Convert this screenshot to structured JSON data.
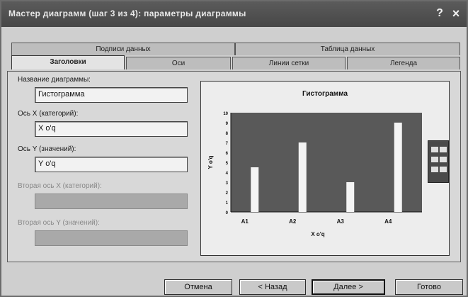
{
  "window": {
    "title": "Мастер диаграмм (шаг 3 из 4): параметры диаграммы",
    "help_glyph": "?",
    "close_glyph": "×"
  },
  "tabs_top": [
    {
      "label": "Подписи данных"
    },
    {
      "label": "Таблица данных"
    }
  ],
  "tabs_bottom": [
    {
      "label": "Заголовки"
    },
    {
      "label": "Оси"
    },
    {
      "label": "Линии сетки"
    },
    {
      "label": "Легенда"
    }
  ],
  "form": {
    "chart_name_label": "Название диаграммы:",
    "chart_name_value": "Гистограмма",
    "x_axis_label": "Ось X (категорий):",
    "x_axis_value": "X o'q",
    "y_axis_label": "Ось Y (значений):",
    "y_axis_value": "Y o'q",
    "x2_axis_label": "Вторая ось X (категорий):",
    "y2_axis_label": "Вторая ось Y (значений):"
  },
  "chart_data": {
    "type": "bar",
    "title": "Гистограмма",
    "xlabel": "X o'q",
    "ylabel": "Y o'q",
    "categories": [
      "A1",
      "A2",
      "A3",
      "A4"
    ],
    "values": [
      4.5,
      7,
      3,
      9
    ],
    "ylim": [
      0,
      10
    ],
    "yticks": [
      "0",
      "1",
      "2",
      "3",
      "4",
      "5",
      "6",
      "7",
      "8",
      "9",
      "10"
    ],
    "plot_background": "#595959",
    "bar_color": "#f4f4f4",
    "gridlines": false,
    "legend": false
  },
  "buttons": {
    "cancel": "Отмена",
    "back": "< Назад",
    "next": "Далее >",
    "finish": "Готово"
  }
}
